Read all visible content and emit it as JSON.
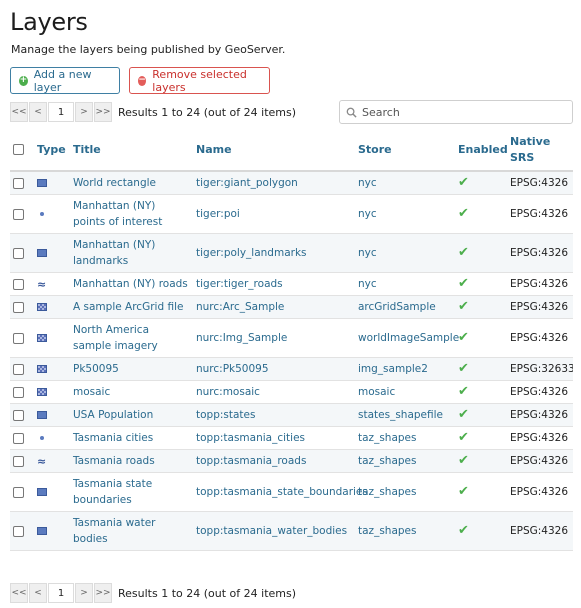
{
  "page": {
    "title": "Layers",
    "description": "Manage the layers being published by GeoServer."
  },
  "actions": {
    "add_label": "Add a new layer",
    "remove_label": "Remove selected layers"
  },
  "pager": {
    "first": "<<",
    "prev": "<",
    "current_page": "1",
    "next": ">",
    "last": ">>",
    "results_text": "Results 1 to 24 (out of 24 items)"
  },
  "search": {
    "placeholder": "Search",
    "value": ""
  },
  "table": {
    "headers": {
      "type": "Type",
      "title": "Title",
      "name": "Name",
      "store": "Store",
      "enabled": "Enabled",
      "srs": "Native SRS"
    },
    "rows": [
      {
        "type_icon": "polygon-icon",
        "title": "World rectangle",
        "name": "tiger:giant_polygon",
        "store": "nyc",
        "enabled": true,
        "srs": "EPSG:4326"
      },
      {
        "type_icon": "point-icon",
        "title": "Manhattan (NY) points of interest",
        "name": "tiger:poi",
        "store": "nyc",
        "enabled": true,
        "srs": "EPSG:4326"
      },
      {
        "type_icon": "polygon-icon",
        "title": "Manhattan (NY) landmarks",
        "name": "tiger:poly_landmarks",
        "store": "nyc",
        "enabled": true,
        "srs": "EPSG:4326"
      },
      {
        "type_icon": "line-icon",
        "title": "Manhattan (NY) roads",
        "name": "tiger:tiger_roads",
        "store": "nyc",
        "enabled": true,
        "srs": "EPSG:4326"
      },
      {
        "type_icon": "raster-icon",
        "title": "A sample ArcGrid file",
        "name": "nurc:Arc_Sample",
        "store": "arcGridSample",
        "enabled": true,
        "srs": "EPSG:4326"
      },
      {
        "type_icon": "raster-icon",
        "title": "North America sample imagery",
        "name": "nurc:Img_Sample",
        "store": "worldImageSample",
        "enabled": true,
        "srs": "EPSG:4326"
      },
      {
        "type_icon": "raster-icon",
        "title": "Pk50095",
        "name": "nurc:Pk50095",
        "store": "img_sample2",
        "enabled": true,
        "srs": "EPSG:32633"
      },
      {
        "type_icon": "raster-icon",
        "title": "mosaic",
        "name": "nurc:mosaic",
        "store": "mosaic",
        "enabled": true,
        "srs": "EPSG:4326"
      },
      {
        "type_icon": "polygon-icon",
        "title": "USA Population",
        "name": "topp:states",
        "store": "states_shapefile",
        "enabled": true,
        "srs": "EPSG:4326"
      },
      {
        "type_icon": "point-icon",
        "title": "Tasmania cities",
        "name": "topp:tasmania_cities",
        "store": "taz_shapes",
        "enabled": true,
        "srs": "EPSG:4326"
      },
      {
        "type_icon": "line-icon",
        "title": "Tasmania roads",
        "name": "topp:tasmania_roads",
        "store": "taz_shapes",
        "enabled": true,
        "srs": "EPSG:4326"
      },
      {
        "type_icon": "polygon-icon",
        "title": "Tasmania state boundaries",
        "name": "topp:tasmania_state_boundaries",
        "store": "taz_shapes",
        "enabled": true,
        "srs": "EPSG:4326"
      },
      {
        "type_icon": "polygon-icon",
        "title": "Tasmania water bodies",
        "name": "topp:tasmania_water_bodies",
        "store": "taz_shapes",
        "enabled": true,
        "srs": "EPSG:4326"
      }
    ]
  },
  "colors": {
    "link": "#2a6a8e",
    "enabled_check": "#4cae4c",
    "remove": "#d9534f"
  }
}
